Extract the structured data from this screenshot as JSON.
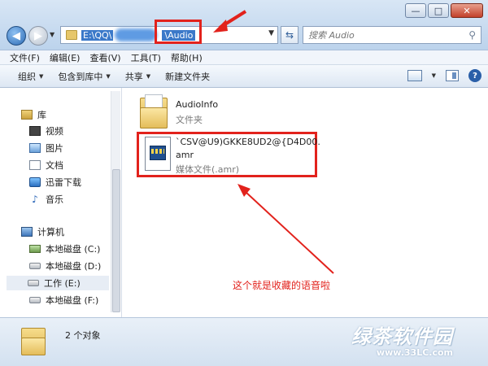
{
  "window": {
    "controls": [
      "—",
      "□",
      "✕"
    ]
  },
  "nav": {
    "back_glyph": "◀",
    "forward_glyph": "▶",
    "dropdown_glyph": "▼"
  },
  "address": {
    "path_start": "E:\\QQ\\",
    "path_end": "\\Audio",
    "dropdown_glyph": "▼",
    "refresh_glyph": "⇆"
  },
  "search": {
    "placeholder": "搜索 Audio",
    "icon": "search-icon"
  },
  "menubar": {
    "items": [
      "文件(F)",
      "编辑(E)",
      "查看(V)",
      "工具(T)",
      "帮助(H)"
    ]
  },
  "toolbar": {
    "organize": "组织",
    "include": "包含到库中",
    "share": "共享",
    "new_folder": "新建文件夹",
    "caret": "▼",
    "help": "?"
  },
  "sidebar": {
    "library": "库",
    "videos": "视频",
    "pictures": "图片",
    "documents": "文档",
    "thunder": "迅雷下载",
    "music": "音乐",
    "music_glyph": "♪",
    "computer": "计算机",
    "drive_c": "本地磁盘 (C:)",
    "drive_d": "本地磁盘 (D:)",
    "drive_e": "工作 (E:)",
    "drive_f": "本地磁盘 (F:)"
  },
  "files": [
    {
      "name": "AudioInfo",
      "type": "文件夹"
    },
    {
      "name_line1": "`CSV@U9)GKKE8UD2@{D4D00.",
      "name_line2": "amr",
      "type": "媒体文件(.amr)"
    }
  ],
  "annotation": {
    "text": "这个就是收藏的语音啦",
    "color": "#e2221c"
  },
  "status": {
    "count": "2 个对象"
  },
  "watermark": {
    "title": "绿茶软件园",
    "url": "www.33LC.com"
  }
}
